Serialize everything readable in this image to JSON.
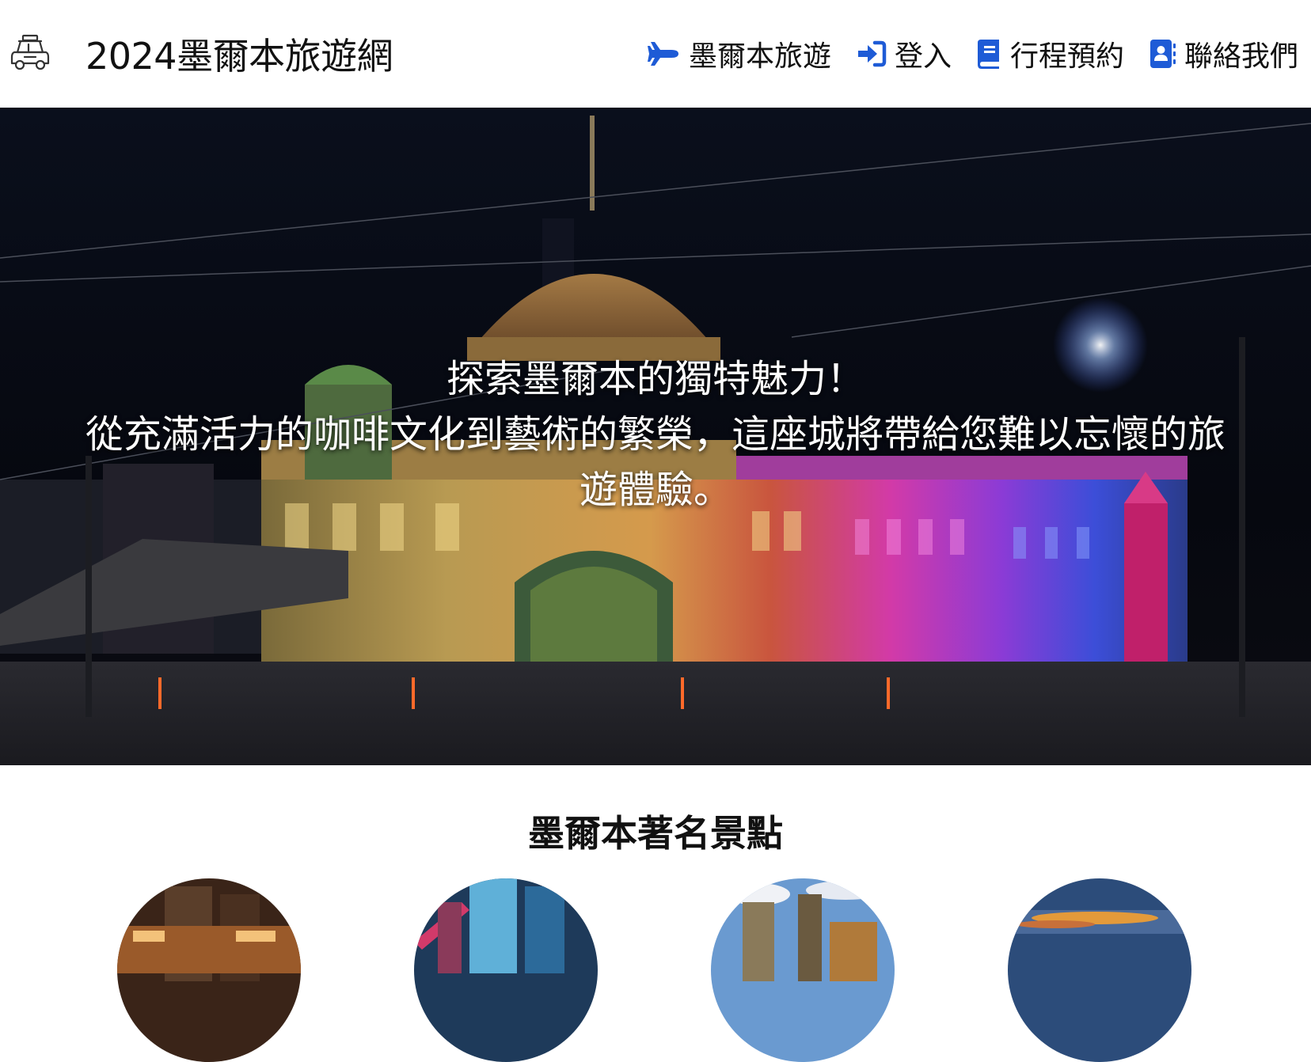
{
  "header": {
    "logo_icon": "car-roofrack-icon",
    "site_title": "2024墨爾本旅遊網"
  },
  "nav": {
    "items": [
      {
        "label": "墨爾本旅遊",
        "icon": "plane-icon"
      },
      {
        "label": "登入",
        "icon": "sign-in-icon"
      },
      {
        "label": "行程預約",
        "icon": "book-icon"
      },
      {
        "label": "聯絡我們",
        "icon": "address-book-icon"
      }
    ],
    "icon_color": "#1e5bd6"
  },
  "hero": {
    "line1": "探索墨爾本的獨特魅力！",
    "line2": "從充滿活力的咖啡文化到藝術的繁榮，這座城將帶給您難以忘懷的旅",
    "line3": "遊體驗。"
  },
  "attractions": {
    "heading": "墨爾本著名景點"
  }
}
